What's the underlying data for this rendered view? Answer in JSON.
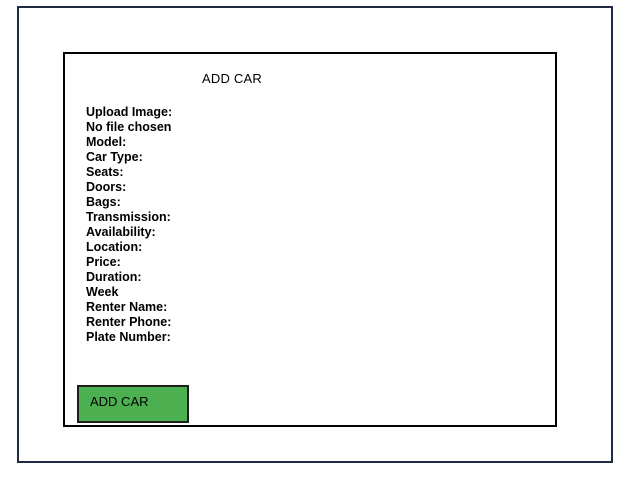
{
  "form": {
    "title": "ADD CAR",
    "fields": [
      "Upload Image:",
      "No file chosen",
      "Model:",
      "Car Type:",
      "Seats:",
      "Doors:",
      "Bags:",
      "Transmission:",
      "Availability:",
      "Location:",
      "Price:",
      "Duration:",
      "Week",
      "Renter Name:",
      "Renter Phone:",
      "Plate Number:"
    ],
    "submit_label": "ADD CAR"
  },
  "colors": {
    "button_bg": "#4caf50",
    "outer_border": "#1f2a44"
  }
}
